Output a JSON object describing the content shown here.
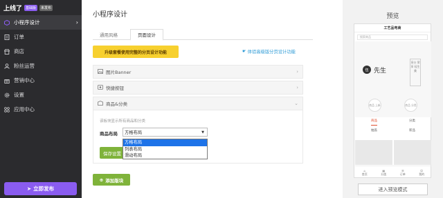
{
  "brand": {
    "name": "上线了",
    "badge_basic": "基础版",
    "badge_unpublished": "未发布"
  },
  "sidebar": {
    "items": [
      {
        "label": "小程序设计",
        "icon": "cube-icon",
        "active": true
      },
      {
        "label": "订单",
        "icon": "order-icon"
      },
      {
        "label": "商店",
        "icon": "store-icon"
      },
      {
        "label": "粉丝运营",
        "icon": "users-icon"
      },
      {
        "label": "营销中心",
        "icon": "gift-icon"
      },
      {
        "label": "设置",
        "icon": "gear-icon"
      },
      {
        "label": "应用中心",
        "icon": "apps-icon"
      }
    ],
    "publish_label": "立即发布"
  },
  "main": {
    "title": "小程序设计",
    "tabs": [
      {
        "label": "通用风格"
      },
      {
        "label": "页面设计",
        "active": true
      }
    ],
    "upgrade_label": "升级套餐使用完整的分页设计功能",
    "try_link": "体验高级版分页设计功能",
    "sections": [
      {
        "label": "图片Banner",
        "icon": "image-icon"
      },
      {
        "label": "快捷按钮",
        "icon": "quick-button-icon"
      },
      {
        "label": "商品&分类",
        "icon": "goods-icon",
        "expanded": true
      }
    ],
    "hint": "该板块显示所有商品和分类",
    "layout_label": "商品布局",
    "layout_value": "方格布局",
    "layout_options": [
      "方格布局",
      "列表布局",
      "滑动布局"
    ],
    "save_label": "保存设置",
    "add_block_label": "添加版块"
  },
  "preview": {
    "title": "预览",
    "phone_header": "工艺品电商",
    "search_placeholder": "搜索商品",
    "logo_char": "伍",
    "logo_text": "先生",
    "vertical_text": "享分 荣 享 轻生 美",
    "circle1": "商品 上新",
    "circle2": "商品 分类",
    "tab1": "商品",
    "tab2": "分类",
    "subtab1": "抽盖",
    "subtab2": "新品",
    "footer": [
      "首页",
      "分类",
      "订单",
      "我的"
    ],
    "enter_button": "进入预览模式"
  }
}
